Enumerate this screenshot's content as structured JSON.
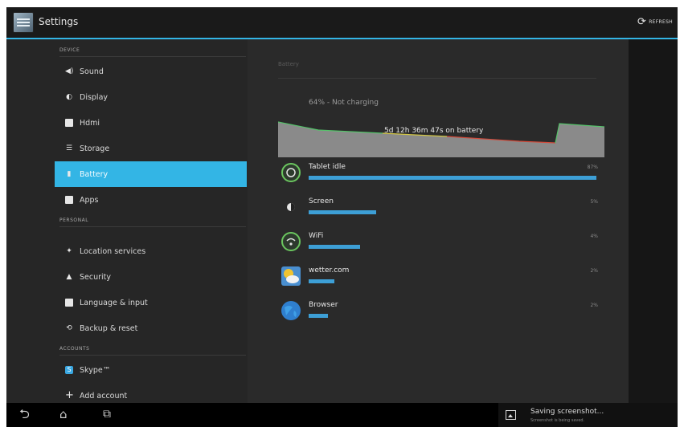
{
  "app": {
    "title": "Settings",
    "refresh_label": "REFRESH"
  },
  "sidebar": {
    "sections": [
      "DEVICE",
      "PERSONAL",
      "ACCOUNTS"
    ],
    "items": [
      {
        "label": "Sound",
        "icon": "speaker-icon"
      },
      {
        "label": "Display",
        "icon": "brightness-icon"
      },
      {
        "label": "Hdmi",
        "icon": "hdmi-icon"
      },
      {
        "label": "Storage",
        "icon": "storage-icon"
      },
      {
        "label": "Battery",
        "icon": "battery-icon",
        "selected": true
      },
      {
        "label": "Apps",
        "icon": "apps-icon"
      },
      {
        "label": "Location services",
        "icon": "location-icon"
      },
      {
        "label": "Security",
        "icon": "lock-icon"
      },
      {
        "label": "Language & input",
        "icon": "language-icon"
      },
      {
        "label": "Backup & reset",
        "icon": "backup-icon"
      },
      {
        "label": "Skype™",
        "icon": "skype-icon"
      },
      {
        "label": "Add account",
        "icon": "plus-icon"
      }
    ]
  },
  "battery": {
    "header": "Battery",
    "status": "64% - Not charging",
    "graph_label": "5d 12h 36m 47s on battery",
    "usage": [
      {
        "name": "Tablet idle",
        "percent": "87%",
        "fraction": 0.87,
        "icon": "tablet-idle-icon"
      },
      {
        "name": "Screen",
        "percent": "5%",
        "fraction": 0.05,
        "icon": "screen-icon"
      },
      {
        "name": "WiFi",
        "percent": "4%",
        "fraction": 0.04,
        "icon": "wifi-icon"
      },
      {
        "name": "wetter.com",
        "percent": "2%",
        "fraction": 0.02,
        "icon": "wetter-icon"
      },
      {
        "name": "Browser",
        "percent": "2%",
        "fraction": 0.015,
        "icon": "browser-icon"
      }
    ]
  },
  "notification": {
    "title": "Saving screenshot...",
    "subtitle": "Screenshot is being saved."
  },
  "colors": {
    "accent": "#33b5e5",
    "bar": "#3d9fd6",
    "background": "#161616"
  }
}
